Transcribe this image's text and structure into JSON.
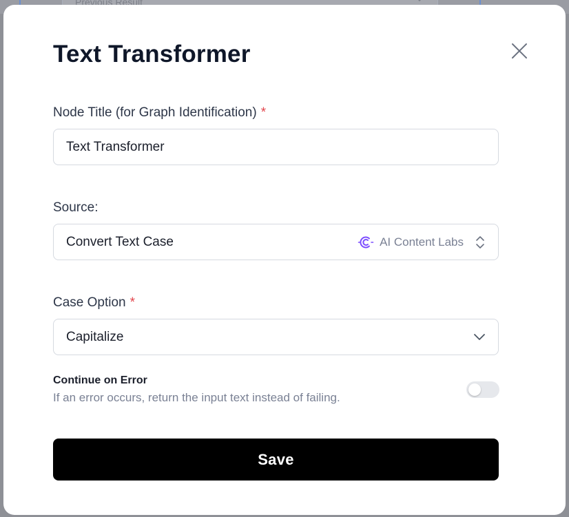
{
  "background": {
    "select_text": "Previous Result"
  },
  "modal": {
    "title": "Text Transformer",
    "close_icon": "close-icon"
  },
  "node_title": {
    "label": "Node Title (for Graph Identification)",
    "required_mark": "*",
    "value": "Text Transformer"
  },
  "source": {
    "label": "Source:",
    "value": "Convert Text Case",
    "provider_name": "AI Content Labs",
    "provider_icon": "ai-content-labs-logo-icon",
    "selector_icon": "up-down-chevron-icon"
  },
  "case_option": {
    "label": "Case Option",
    "required_mark": "*",
    "value": "Capitalize",
    "dropdown_icon": "chevron-down-icon"
  },
  "continue_on_error": {
    "title": "Continue on Error",
    "description": "If an error occurs, return the input text instead of failing.",
    "enabled": false
  },
  "save_button": {
    "label": "Save"
  },
  "colors": {
    "required": "#e2454c",
    "provider_icon": "#7c4dff",
    "primary_button": "#000000"
  }
}
